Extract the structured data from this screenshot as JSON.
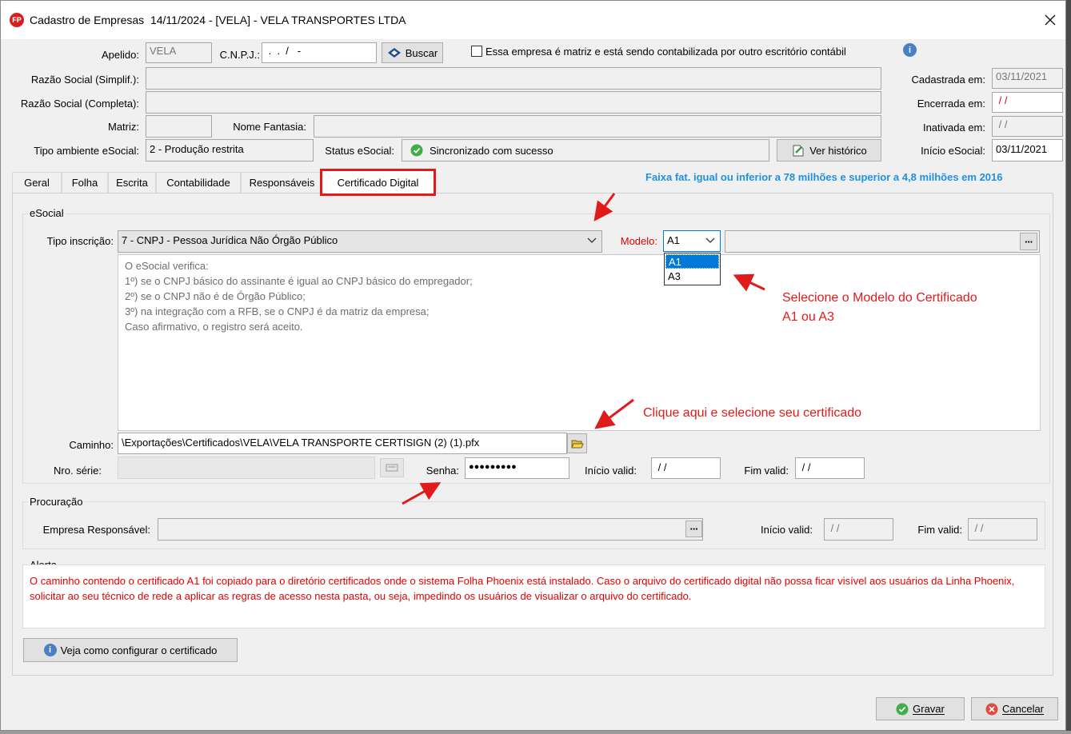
{
  "window": {
    "title": "Cadastro de Empresas  14/11/2024 - [VELA] - VELA TRANSPORTES LTDA",
    "logo_text": "FP"
  },
  "header": {
    "apelido_label": "Apelido:",
    "apelido_value": "VELA",
    "cnpj_label": "C.N.P.J.:",
    "cnpj_value": " .  .  /   -",
    "buscar_label": "Buscar",
    "matriz_checkbox_label": "Essa empresa é matriz e está sendo contabilizada por outro escritório contábil",
    "razao_simplif_label": "Razão Social (Simplif.):",
    "razao_simplif_value": "",
    "razao_completa_label": "Razão Social (Completa):",
    "razao_completa_value": "",
    "matriz_label": "Matriz:",
    "matriz_value": "",
    "nome_fantasia_label": "Nome Fantasia:",
    "nome_fantasia_value": "",
    "tipo_ambiente_label": "Tipo ambiente eSocial:",
    "tipo_ambiente_value": "2 - Produção restrita",
    "status_label": "Status eSocial:",
    "status_value": "Sincronizado com sucesso",
    "ver_historico_label": "Ver histórico",
    "cadastrada_label": "Cadastrada em:",
    "cadastrada_value": "03/11/2021",
    "encerrada_label": "Encerrada em:",
    "encerrada_value": " / /",
    "inativada_label": "Inativada em:",
    "inativada_value": " / /",
    "inicio_esocial_label": "Início eSocial:",
    "inicio_esocial_value": "03/11/2021"
  },
  "tabs": [
    {
      "label": "Geral"
    },
    {
      "label": "Folha"
    },
    {
      "label": "Escrita"
    },
    {
      "label": "Contabilidade"
    },
    {
      "label": "Responsáveis"
    },
    {
      "label": "Certificado Digital"
    }
  ],
  "faixa_text": "Faixa fat. igual ou inferior a 78 milhões e superior a 4,8 milhões em 2016",
  "esocial": {
    "group_title": "eSocial",
    "tipo_inscricao_label": "Tipo inscrição:",
    "tipo_inscricao_value": "7 - CNPJ - Pessoa Jurídica Não Órgão Público",
    "modelo_label": "Modelo:",
    "modelo_value": "A1",
    "modelo_options": [
      "A1",
      "A3"
    ],
    "info_lines": [
      "O eSocial verifica:",
      "1º) se o CNPJ básico do assinante é igual ao CNPJ básico do empregador;",
      "2º) se o CNPJ não é de Órgão Público;",
      "3º) na integração com a RFB, se o CNPJ é da matriz da empresa;",
      "Caso afirmativo, o registro será aceito."
    ],
    "caminho_label": "Caminho:",
    "caminho_value": "\\Exportações\\Certificados\\VELA\\VELA TRANSPORTE CERTISIGN (2) (1).pfx",
    "nro_serie_label": "Nro. série:",
    "nro_serie_value": "",
    "senha_label": "Senha:",
    "senha_value": "●●●●●●●●●",
    "inicio_valid_label": "Início valid:",
    "inicio_valid_value": " / /",
    "fim_valid_label": "Fim valid:",
    "fim_valid_value": " / /"
  },
  "procuracao": {
    "group_title": "Procuração",
    "empresa_label": "Empresa Responsável:",
    "empresa_value": "",
    "inicio_valid_label": "Início valid:",
    "inicio_valid_value": " / /",
    "fim_valid_label": "Fim valid:",
    "fim_valid_value": " / /"
  },
  "alerta": {
    "group_title": "Alerta",
    "text": "O caminho contendo o certificado A1 foi copiado para o diretório certificados onde o sistema Folha Phoenix está instalado. Caso o arquivo do certificado digital não possa ficar visível aos usuários da Linha Phoenix, solicitar ao seu técnico de rede a aplicar as regras de acesso nesta pasta, ou seja, impedindo os usuários de visualizar o arquivo do certificado."
  },
  "veja_como_label": "Veja como configurar o certificado",
  "footer": {
    "gravar_label": "Gravar",
    "cancelar_label": "Cancelar"
  },
  "annotations": {
    "modelo_note_line1": "Selecione o Modelo do Certificado",
    "modelo_note_line2": "A1 ou A3",
    "caminho_note": "Clique aqui e selecione seu certificado"
  },
  "colors": {
    "accent_blue": "#1e90e6",
    "alert_red": "#e20000",
    "annotation_red": "#e11b1b",
    "selection_blue": "#0078d7"
  }
}
